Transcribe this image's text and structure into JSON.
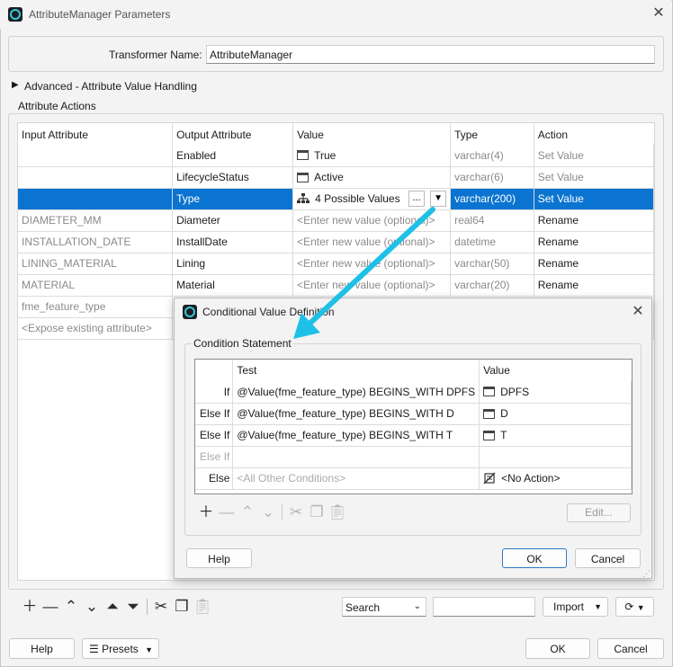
{
  "window": {
    "title": "AttributeManager Parameters",
    "close_icon": "close-icon"
  },
  "transformer": {
    "label": "Transformer Name:",
    "value": "AttributeManager"
  },
  "advanced": {
    "label": "Advanced - Attribute Value Handling"
  },
  "actions": {
    "group_label": "Attribute Actions",
    "columns": [
      "Input Attribute",
      "Output Attribute",
      "Value",
      "Type",
      "Action"
    ],
    "rows": [
      {
        "input": "",
        "output": "Enabled",
        "value": "True",
        "value_icon": "checkbox-icon",
        "type": "varchar(4)",
        "action": "Set Value"
      },
      {
        "input": "",
        "output": "LifecycleStatus",
        "value": "Active",
        "value_icon": "checkbox-icon",
        "type": "varchar(6)",
        "action": "Set Value"
      },
      {
        "input": "",
        "output": "Type",
        "value": "4 Possible Values",
        "value_icon": "conditional-tree-icon",
        "type": "varchar(200)",
        "action": "Set Value",
        "selected": true
      },
      {
        "input": "DIAMETER_MM",
        "output": "Diameter",
        "value": "<Enter new value (optional)>",
        "type": "real64",
        "action": "Rename"
      },
      {
        "input": "INSTALLATION_DATE",
        "output": "InstallDate",
        "value": "<Enter new value (optional)>",
        "type": "datetime",
        "action": "Rename"
      },
      {
        "input": "LINING_MATERIAL",
        "output": "Lining",
        "value": "<Enter new value (optional)>",
        "type": "varchar(50)",
        "action": "Rename"
      },
      {
        "input": "MATERIAL",
        "output": "Material",
        "value": "<Enter new value (optional)>",
        "type": "varchar(20)",
        "action": "Rename"
      },
      {
        "input": "fme_feature_type",
        "output": "",
        "value": "",
        "type": "",
        "action": ""
      },
      {
        "input": "<Expose existing attribute>",
        "output": "",
        "value": "",
        "type": "",
        "action": ""
      }
    ],
    "ellipsis": "...",
    "search_label": "Search",
    "import_label": "Import"
  },
  "dialog": {
    "title": "Conditional Value Definition",
    "group_label": "Condition Statement",
    "columns": [
      "Test",
      "Value"
    ],
    "rows": [
      {
        "label": "If",
        "test": "@Value(fme_feature_type) BEGINS_WITH DPFS",
        "value": "DPFS",
        "value_icon": "checkbox-icon"
      },
      {
        "label": "Else If",
        "test": "@Value(fme_feature_type) BEGINS_WITH D",
        "value": "D",
        "value_icon": "checkbox-icon"
      },
      {
        "label": "Else If",
        "test": "@Value(fme_feature_type) BEGINS_WITH T",
        "value": "T",
        "value_icon": "checkbox-icon"
      },
      {
        "label": "Else If",
        "test": "",
        "value": "",
        "disabled": true
      },
      {
        "label": "Else",
        "test": "<All Other Conditions>",
        "value": "<No Action>",
        "value_icon": "no-action-icon",
        "test_placeholder": true
      }
    ],
    "edit_label": "Edit...",
    "help_label": "Help",
    "ok_label": "OK",
    "cancel_label": "Cancel"
  },
  "footer": {
    "help_label": "Help",
    "presets_label": "Presets",
    "ok_label": "OK",
    "cancel_label": "Cancel"
  },
  "colors": {
    "selection": "#0b74d0",
    "arrow": "#1fc0e6",
    "accent_border": "#2a79c9"
  }
}
